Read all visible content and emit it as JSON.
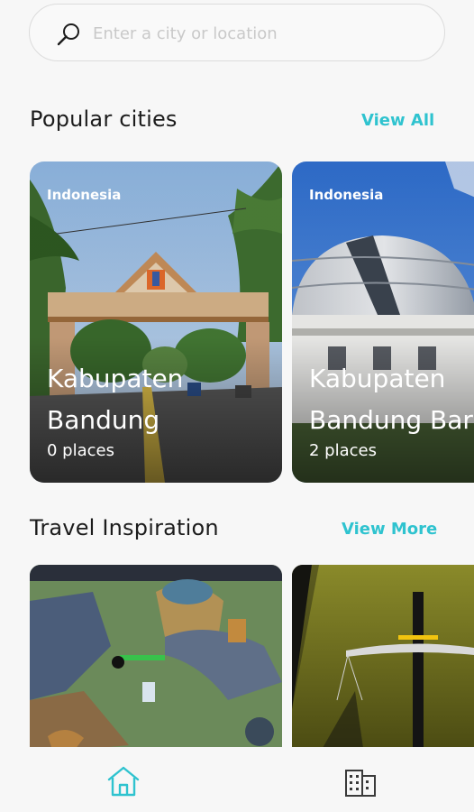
{
  "search": {
    "placeholder": "Enter a city or location",
    "icon": "search-icon"
  },
  "popular": {
    "title": "Popular cities",
    "link_label": "View All",
    "cards": [
      {
        "country": "Indonesia",
        "name_line1": "Kabupaten",
        "name_line2": "Bandung",
        "places": "0 places"
      },
      {
        "country": "Indonesia",
        "name_line1": "Kabupaten",
        "name_line2": "Bandung Barat",
        "places": "2 places"
      }
    ]
  },
  "inspiration": {
    "title": "Travel Inspiration",
    "link_label": "View More"
  },
  "nav": {
    "items": [
      {
        "icon": "home-icon",
        "active": true
      },
      {
        "icon": "city-buildings-icon",
        "active": false
      }
    ]
  },
  "colors": {
    "accent": "#2fc3cf",
    "background": "#f7f7f7",
    "text": "#1e1e1e"
  }
}
